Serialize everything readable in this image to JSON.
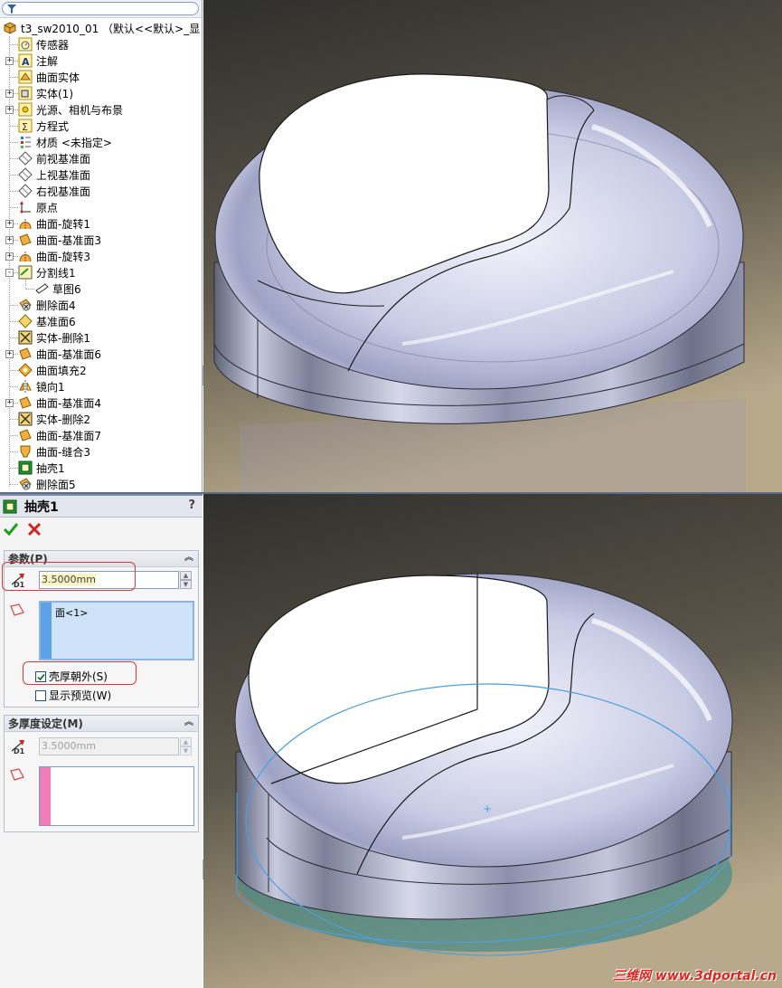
{
  "tree": {
    "root_label": "t3_sw2010_01 （默认<<默认>_显",
    "items": [
      {
        "label": "传感器",
        "icon": "sensor-icon",
        "expand": ""
      },
      {
        "label": "注解",
        "icon": "annotation-icon",
        "expand": "+"
      },
      {
        "label": "曲面实体",
        "icon": "surface-bodies-icon",
        "expand": ""
      },
      {
        "label": "实体(1)",
        "icon": "solid-bodies-icon",
        "expand": "+"
      },
      {
        "label": "光源、相机与布景",
        "icon": "lights-cameras-icon",
        "expand": "+"
      },
      {
        "label": "方程式",
        "icon": "equations-icon",
        "expand": ""
      },
      {
        "label": "材质 <未指定>",
        "icon": "material-icon",
        "expand": ""
      },
      {
        "label": "前视基准面",
        "icon": "plane-icon",
        "expand": ""
      },
      {
        "label": "上视基准面",
        "icon": "plane-icon",
        "expand": ""
      },
      {
        "label": "右视基准面",
        "icon": "plane-icon",
        "expand": ""
      },
      {
        "label": "原点",
        "icon": "origin-icon",
        "expand": ""
      },
      {
        "label": "曲面-旋转1",
        "icon": "surface-revolve-icon",
        "expand": "+"
      },
      {
        "label": "曲面-基准面3",
        "icon": "planar-surface-icon",
        "expand": "+"
      },
      {
        "label": "曲面-旋转3",
        "icon": "surface-revolve-icon",
        "expand": "+"
      },
      {
        "label": "分割线1",
        "icon": "split-line-icon",
        "expand": "-"
      },
      {
        "label": "草图6",
        "icon": "sketch-icon",
        "expand": "",
        "child": true
      },
      {
        "label": "删除面4",
        "icon": "delete-face-icon",
        "expand": ""
      },
      {
        "label": "基准面6",
        "icon": "reference-plane-icon",
        "expand": ""
      },
      {
        "label": "实体-删除1",
        "icon": "delete-body-icon",
        "expand": ""
      },
      {
        "label": "曲面-基准面6",
        "icon": "planar-surface-icon",
        "expand": "+"
      },
      {
        "label": "曲面填充2",
        "icon": "fill-surface-icon",
        "expand": ""
      },
      {
        "label": "镜向1",
        "icon": "mirror-icon",
        "expand": ""
      },
      {
        "label": "曲面-基准面4",
        "icon": "planar-surface-icon",
        "expand": "+"
      },
      {
        "label": "实体-删除2",
        "icon": "delete-body-icon",
        "expand": ""
      },
      {
        "label": "曲面-基准面7",
        "icon": "planar-surface-icon",
        "expand": ""
      },
      {
        "label": "曲面-缝合3",
        "icon": "knit-surface-icon",
        "expand": ""
      },
      {
        "label": "抽壳1",
        "icon": "shell-icon",
        "expand": ""
      },
      {
        "label": "删除面5",
        "icon": "delete-face-icon",
        "expand": ""
      }
    ]
  },
  "property_manager": {
    "title": "抽壳1",
    "help": "?",
    "parameters": {
      "heading": "参数(P)",
      "thickness_value": "3.5000mm",
      "thickness_icon_label": "D1",
      "faces_list": [
        "面<1>"
      ],
      "shell_outward_label": "壳厚朝外(S)",
      "shell_outward_checked": true,
      "show_preview_label": "显示预览(W)",
      "show_preview_checked": false
    },
    "multi_thickness": {
      "heading": "多厚度设定(M)",
      "thickness_value": "3.5000mm",
      "thickness_icon_label": "D1"
    }
  },
  "watermark": "三维网 www.3dportal.cn",
  "colors": {
    "viewport_top": "#3a3a36",
    "viewport_bottom": "#b3a586",
    "model_gray": "#a9adc9",
    "selection_blue": "#4a9fe0",
    "accent_red": "#d63a3a"
  }
}
